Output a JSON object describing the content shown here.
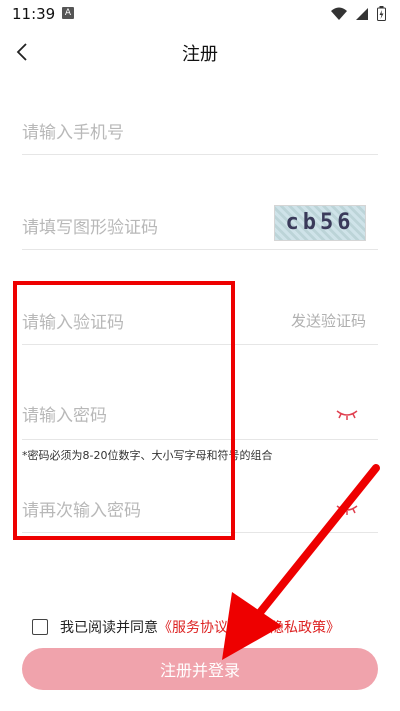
{
  "status": {
    "time": "11:39",
    "notif_letter": "A"
  },
  "header": {
    "title": "注册"
  },
  "form": {
    "phone_placeholder": "请输入手机号",
    "captcha_placeholder": "请填写图形验证码",
    "captcha_text": "cb56",
    "sms_placeholder": "请输入验证码",
    "send_code": "发送验证码",
    "password_placeholder": "请输入密码",
    "password_hint": "*密码必须为8-20位数字、大小写字母和符号的组合",
    "confirm_placeholder": "请再次输入密码"
  },
  "agreement": {
    "prefix": "我已阅读并同意",
    "service_link": "《服务协议》",
    "and": "和",
    "privacy_link": "《隐私政策》"
  },
  "submit": {
    "label": "注册并登录"
  },
  "colors": {
    "accent": "#f0a3ac",
    "link": "#d22222",
    "annotation": "#ee0000"
  }
}
